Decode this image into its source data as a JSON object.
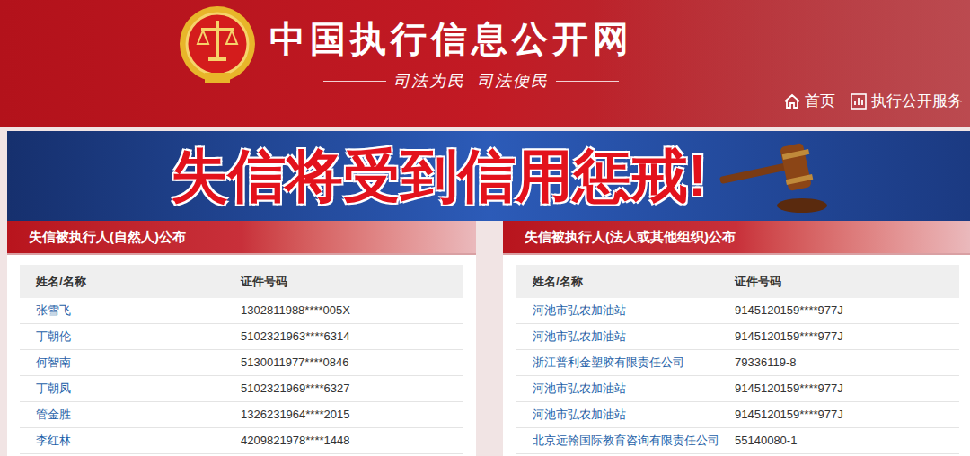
{
  "site": {
    "title": "中国执行信息公开网",
    "slogan": "司法为民  司法便民"
  },
  "nav": [
    {
      "label": "首页"
    },
    {
      "label": "执行公开服务"
    }
  ],
  "banner": {
    "text": "失信将受到信用惩戒!"
  },
  "panels": [
    {
      "title": "失信被执行人(自然人)公布",
      "columns": [
        "姓名/名称",
        "证件号码"
      ],
      "rows": [
        [
          "张雪飞",
          "1302811988****005X"
        ],
        [
          "丁朝伦",
          "5102321963****6314"
        ],
        [
          "何智南",
          "5130011977****0846"
        ],
        [
          "丁朝凤",
          "5102321969****6327"
        ],
        [
          "管金胜",
          "1326231964****2015"
        ],
        [
          "李红林",
          "4209821978****1448"
        ]
      ]
    },
    {
      "title": "失信被执行人(法人或其他组织)公布",
      "columns": [
        "姓名/名称",
        "证件号码"
      ],
      "rows": [
        [
          "河池市弘农加油站",
          "9145120159****977J"
        ],
        [
          "河池市弘农加油站",
          "9145120159****977J"
        ],
        [
          "浙江普利金塑胶有限责任公司",
          "79336119-8"
        ],
        [
          "河池市弘农加油站",
          "9145120159****977J"
        ],
        [
          "河池市弘农加油站",
          "9145120159****977J"
        ],
        [
          "北京远翰国际教育咨询有限责任公司",
          "55140080-1"
        ]
      ]
    }
  ]
}
